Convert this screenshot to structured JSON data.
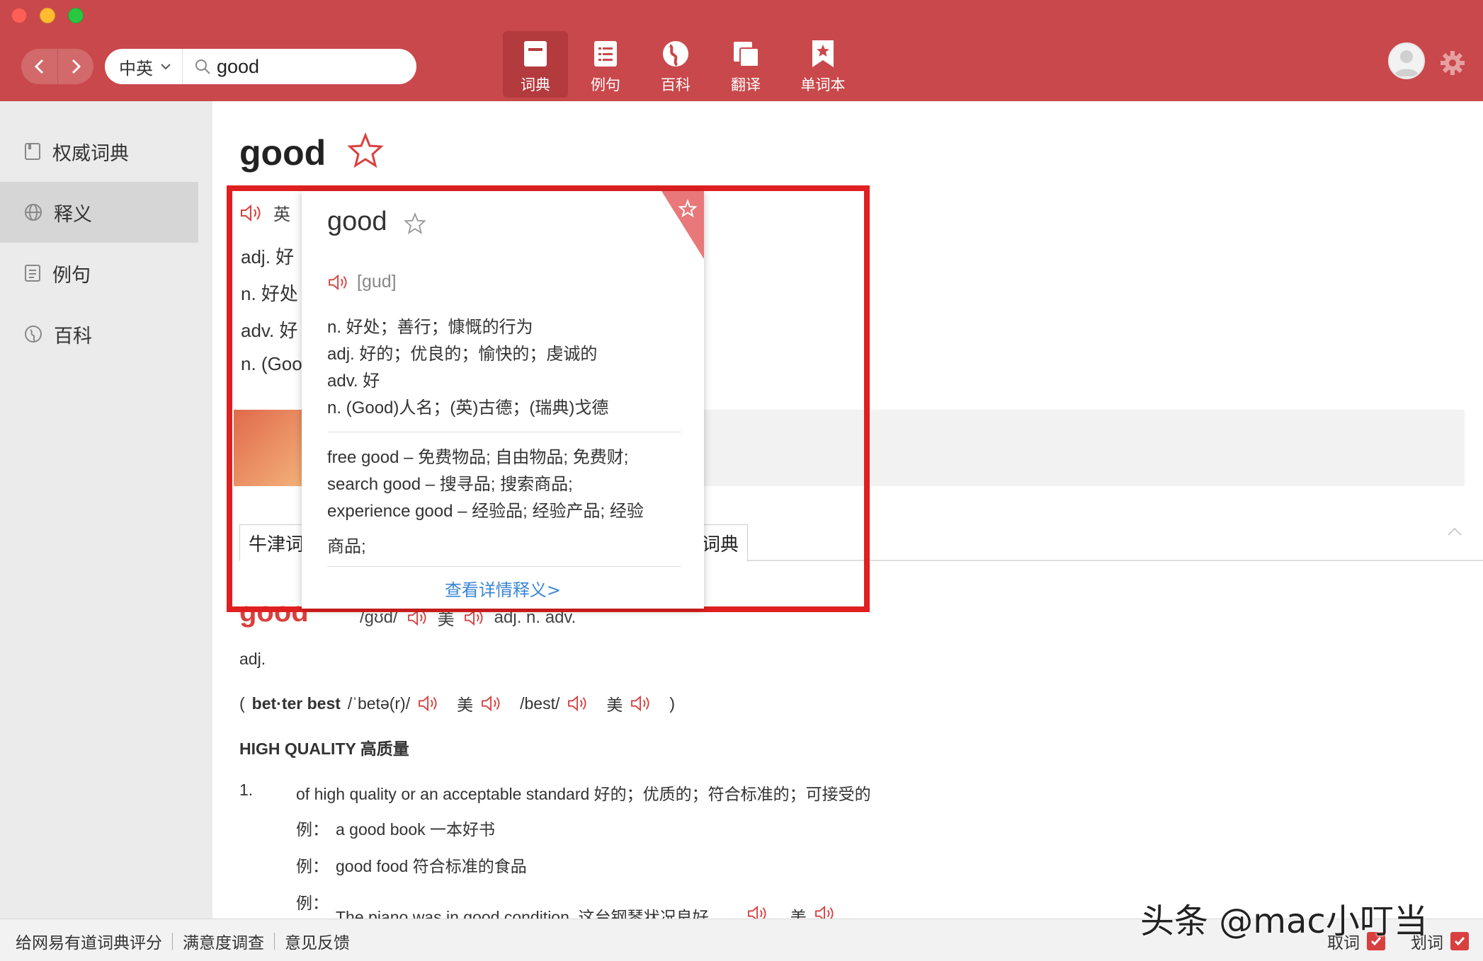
{
  "toolbar": {
    "lang_select": "中英",
    "search_value": "good",
    "tabs": [
      {
        "label": "词典",
        "icon": "dictionary-icon",
        "active": true
      },
      {
        "label": "例句",
        "icon": "list-icon",
        "active": false
      },
      {
        "label": "百科",
        "icon": "globe-icon",
        "active": false
      },
      {
        "label": "翻译",
        "icon": "translate-icon",
        "active": false
      },
      {
        "label": "单词本",
        "icon": "bookmark-star-icon",
        "active": false
      }
    ]
  },
  "sidebar": {
    "items": [
      {
        "label": "权威词典",
        "icon": "book-icon"
      },
      {
        "label": "释义",
        "icon": "globe-icon",
        "active": true
      },
      {
        "label": "例句",
        "icon": "doc-icon"
      },
      {
        "label": "百科",
        "icon": "compass-icon"
      }
    ]
  },
  "main": {
    "word": "good",
    "pron_label": "英",
    "brief": [
      "adj. 好",
      "n. 好处",
      "adv. 好",
      "n. (Goo"
    ],
    "dict_tabs": [
      "牛津词",
      "词典"
    ],
    "entry": {
      "word": "good",
      "phon": "/gʊd/",
      "us_label": "美",
      "pos": "adj. n. adv.",
      "adj_label": "adj.",
      "forms_prefix": "(",
      "forms_bold": "bet·ter best",
      "forms_phon1": "/ˈbetə(r)/",
      "forms_us": "美",
      "forms_phon2": "/best/",
      "forms_us2": "美",
      "forms_suffix": ")",
      "section": "HIGH QUALITY 高质量",
      "sense_num": "1.",
      "sense_def": "of high quality or an acceptable standard 好的；优质的；符合标准的；可接受的",
      "example_prefix": "例：",
      "examples": [
        "a good book 一本好书",
        "good food 符合标准的食品",
        "The piano was in good condition. 这台钢琴状况良好。"
      ],
      "example_us": "美"
    }
  },
  "popup": {
    "word": "good",
    "phonetic": "[gud]",
    "defs": [
      "n. 好处；善行；慷慨的行为",
      "adj. 好的；优良的；愉快的；虔诚的",
      "adv. 好",
      "n. (Good)人名；(英)古德；(瑞典)戈德"
    ],
    "phrases": [
      "free good – 免费物品; 自由物品; 免费财;",
      "search good – 搜寻品; 搜索商品;",
      "experience good – 经验品; 经验产品; 经验",
      "商品;"
    ],
    "more_link": "查看详情释义>"
  },
  "statusbar": {
    "links": [
      "给网易有道词典评分",
      "满意度调查",
      "意见反馈"
    ],
    "toggle1": "取词",
    "toggle2": "划词"
  },
  "watermark": "头条 @mac小叮当",
  "colors": {
    "toolbar": "#c9484b",
    "accent": "#d8403f",
    "highlight_box": "#e02020",
    "link": "#3a86d4"
  }
}
